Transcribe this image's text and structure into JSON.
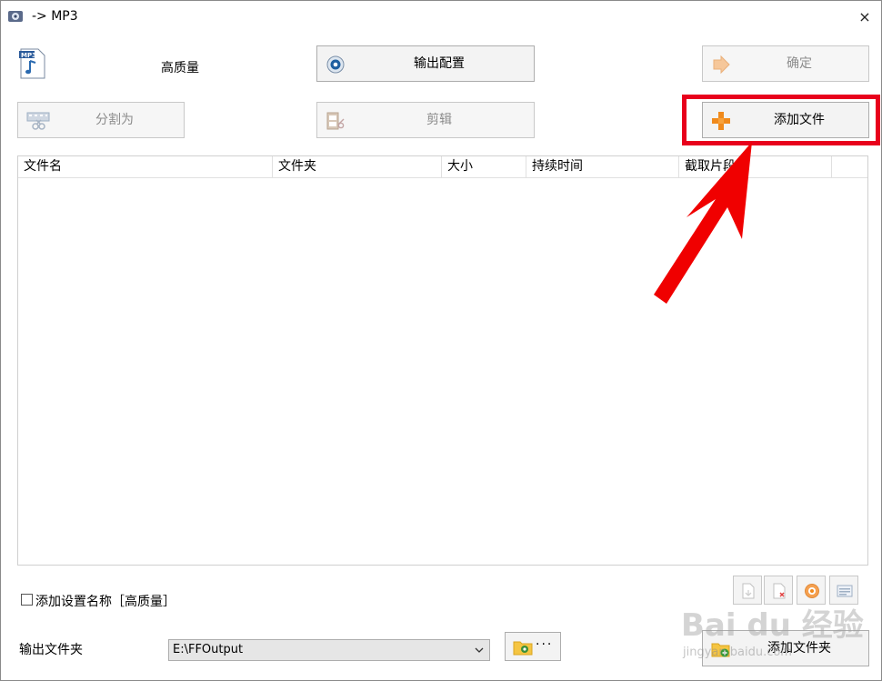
{
  "window": {
    "title": "-> MP3",
    "close_glyph": "×"
  },
  "preset": {
    "quality_label": "高质量",
    "icon": "mp3-file-icon"
  },
  "buttons": {
    "output_config": "输出配置",
    "ok": "确定",
    "split": "分割为",
    "edit": "剪辑",
    "add_file": "添加文件",
    "add_folder": "添加文件夹"
  },
  "table": {
    "columns": [
      "文件名",
      "文件夹",
      "大小",
      "持续时间",
      "截取片段"
    ]
  },
  "options": {
    "add_setting_name_label": "添加设置名称［高质量］",
    "add_setting_name_checked": false
  },
  "output": {
    "label": "输出文件夹",
    "folder_value": "E:\\FFOutput",
    "browse_dots": "···"
  },
  "watermark": {
    "text": "Bai du 经验",
    "sub": "jingyan.baidu.com"
  },
  "colors": {
    "highlight": "#e8001c",
    "accent_orange": "#f08a1c"
  }
}
